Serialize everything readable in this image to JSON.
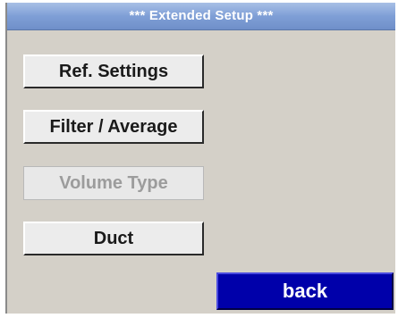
{
  "header": {
    "title": "***   Extended Setup ***"
  },
  "menu": {
    "items": [
      {
        "label": "Ref. Settings",
        "enabled": true
      },
      {
        "label": "Filter / Average",
        "enabled": true
      },
      {
        "label": "Volume Type",
        "enabled": false
      },
      {
        "label": "Duct",
        "enabled": true
      }
    ]
  },
  "footer": {
    "back_label": "back"
  },
  "colors": {
    "title_bar": "#7f9fd6",
    "back_button": "#0000aa",
    "background": "#d4d0c8",
    "disabled_text": "#9c9c9c"
  }
}
